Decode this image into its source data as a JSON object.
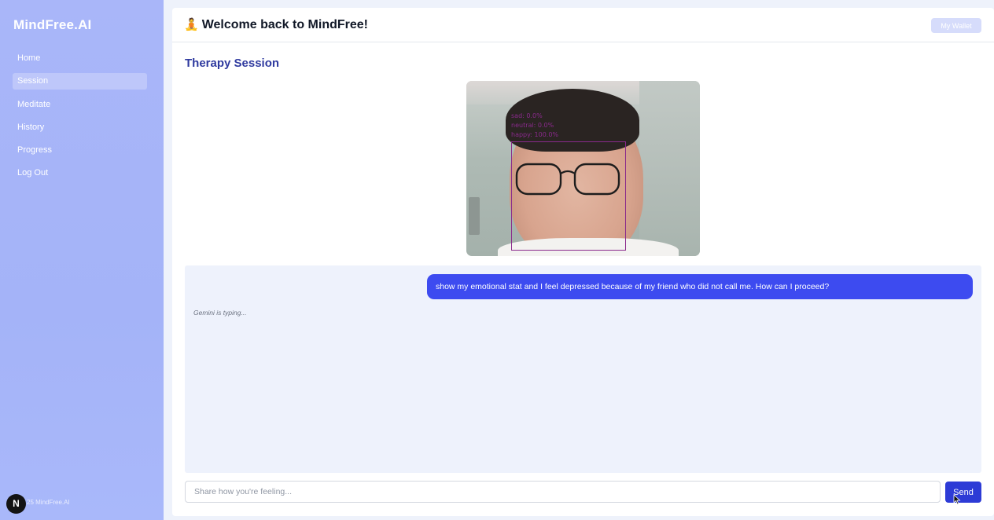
{
  "sidebar": {
    "brand": "MindFree.AI",
    "items": [
      {
        "label": "Home"
      },
      {
        "label": "Session",
        "active": true
      },
      {
        "label": "Meditate"
      },
      {
        "label": "History"
      },
      {
        "label": "Progress"
      },
      {
        "label": "Log Out"
      }
    ],
    "footer_logo": "N",
    "footer_text": "25 MindFree.AI"
  },
  "header": {
    "emoji_icon": "🧘",
    "welcome": "Welcome back to MindFree!",
    "wallet_label": "My Wallet"
  },
  "session": {
    "title": "Therapy Session",
    "emotions": [
      {
        "text": "sad: 0.0%"
      },
      {
        "text": "neutral: 0.0%"
      },
      {
        "text": "happy: 100.0%"
      }
    ]
  },
  "chat": {
    "user_message": "show my emotional stat and I feel depressed because of my friend who did not call me. How can I proceed?",
    "typing_status": "Gemini is typing..."
  },
  "composer": {
    "placeholder": "Share how you're feeling...",
    "send_label": "Send"
  },
  "colors": {
    "sidebar": "#a9b6f9",
    "accent": "#3d4bf0",
    "send": "#2d3bd6",
    "title": "#2f3a9f",
    "face_box": "#8a2a8c"
  }
}
